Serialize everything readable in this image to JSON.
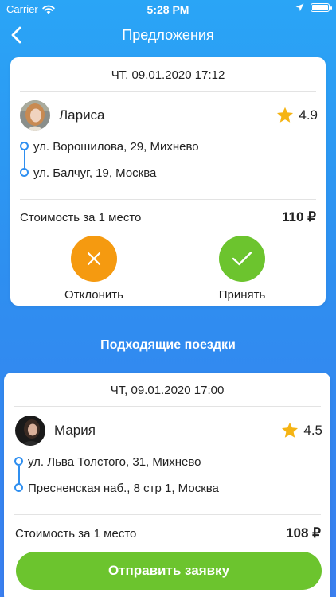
{
  "status_bar": {
    "carrier": "Carrier",
    "time": "5:28 PM"
  },
  "nav": {
    "title": "Предложения"
  },
  "offer": {
    "date": "ЧТ, 09.01.2020 17:12",
    "driver_name": "Лариса",
    "rating": "4.9",
    "from": "ул. Ворошилова, 29, Михнево",
    "to": "ул. Балчуг, 19, Москва",
    "price_label": "Стоимость за 1 место",
    "price": "110 ₽",
    "decline_label": "Отклонить",
    "accept_label": "Принять"
  },
  "section_title": "Подходящие поездки",
  "trip": {
    "date": "ЧТ, 09.01.2020 17:00",
    "driver_name": "Мария",
    "rating": "4.5",
    "from": "ул. Льва Толстого, 31, Михнево",
    "to": "Пресненская наб., 8 стр 1, Москва",
    "price_label": "Стоимость за 1 место",
    "price": "108 ₽",
    "submit_label": "Отправить заявку"
  },
  "colors": {
    "accent_blue": "#2f8ff0",
    "decline_orange": "#f59a10",
    "accept_green": "#6cc42e",
    "star_yellow": "#f5b414"
  }
}
